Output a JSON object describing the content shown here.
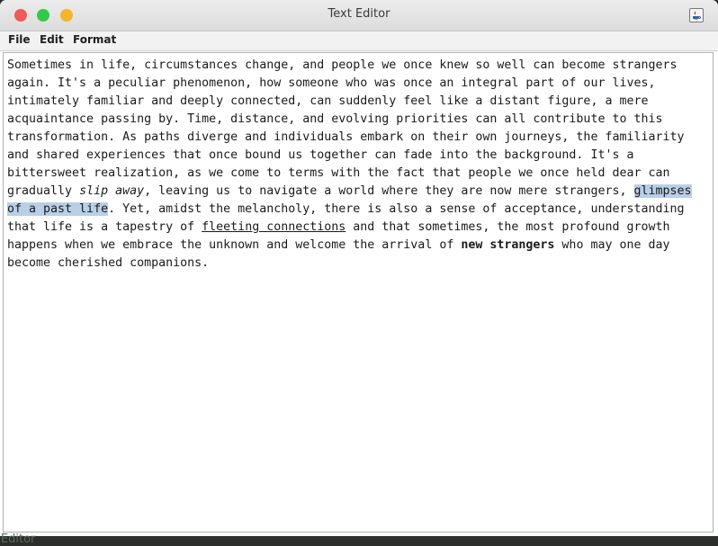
{
  "window": {
    "title": "Text Editor"
  },
  "menubar": {
    "items": [
      "File",
      "Edit",
      "Format"
    ]
  },
  "document": {
    "segments": [
      {
        "text": "Sometimes in life, circumstances change, and people we once knew so well can become strangers again. It's a peculiar phenomenon, how someone who was once an integral part of our lives, intimately familiar and deeply connected, can suddenly feel like a distant figure, a mere acquaintance passing by. Time, distance, and evolving priorities can all contribute to this transformation. As paths diverge and individuals embark on their own journeys, the familiarity and shared experiences that once bound us together can fade into the background. It's a bittersweet realization, as we come to terms with the fact that people we once held dear can gradually ",
        "style": "normal"
      },
      {
        "text": "slip away",
        "style": "italic"
      },
      {
        "text": ", leaving us to navigate a world where they are now mere strangers, ",
        "style": "normal"
      },
      {
        "text": "glimpses of a past life",
        "style": "selected"
      },
      {
        "text": ". Yet, amidst the melancholy, there is also a sense of acceptance, understanding that life is a tapestry of ",
        "style": "normal"
      },
      {
        "text": "fleeting connections",
        "style": "underline"
      },
      {
        "text": " and that sometimes, the most profound growth happens when we embrace the unknown and welcome the arrival of ",
        "style": "normal"
      },
      {
        "text": "new strangers",
        "style": "bold"
      },
      {
        "text": " who may one day become cherished companions.",
        "style": "normal"
      }
    ]
  },
  "background_window": {
    "title_fragment": "xt Editor"
  },
  "colors": {
    "selection": "#b8cfe6",
    "close": "#ed5b5b",
    "minimize": "#34c84a",
    "maximize": "#f4b42c"
  }
}
